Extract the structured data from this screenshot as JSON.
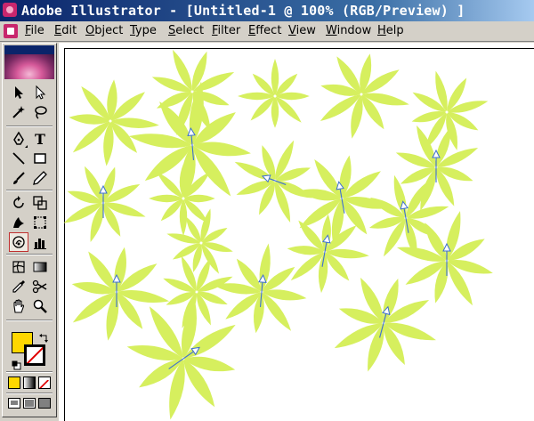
{
  "window": {
    "title": "Adobe Illustrator - [Untitled-1 @ 100% (RGB/Preview) ]",
    "app_icon": "illustrator-flower-icon"
  },
  "menubar": {
    "items": [
      "File",
      "Edit",
      "Object",
      "Type",
      "Select",
      "Filter",
      "Effect",
      "View",
      "Window",
      "Help"
    ]
  },
  "toolbox": {
    "tools": [
      {
        "name": "selection-tool",
        "icon": "black-arrow-icon"
      },
      {
        "name": "direct-selection-tool",
        "icon": "white-arrow-icon"
      },
      {
        "name": "magic-wand-tool",
        "icon": "magic-wand-icon"
      },
      {
        "name": "lasso-tool",
        "icon": "lasso-icon"
      },
      {
        "name": "pen-tool",
        "icon": "pen-icon"
      },
      {
        "name": "type-tool",
        "icon": "type-icon",
        "label": "T"
      },
      {
        "name": "line-segment-tool",
        "icon": "line-icon"
      },
      {
        "name": "rectangle-tool",
        "icon": "rectangle-icon"
      },
      {
        "name": "paintbrush-tool",
        "icon": "paintbrush-icon"
      },
      {
        "name": "pencil-tool",
        "icon": "pencil-icon"
      },
      {
        "name": "rotate-tool",
        "icon": "rotate-icon"
      },
      {
        "name": "scale-tool",
        "icon": "scale-icon"
      },
      {
        "name": "warp-tool",
        "icon": "warp-icon"
      },
      {
        "name": "free-transform-tool",
        "icon": "free-transform-icon"
      },
      {
        "name": "symbol-sprayer-tool",
        "icon": "symbol-sprayer-icon",
        "selected": true
      },
      {
        "name": "column-graph-tool",
        "icon": "graph-icon"
      },
      {
        "name": "mesh-tool",
        "icon": "mesh-icon"
      },
      {
        "name": "gradient-tool",
        "icon": "gradient-icon"
      },
      {
        "name": "eyedropper-tool",
        "icon": "eyedropper-icon"
      },
      {
        "name": "scissors-tool",
        "icon": "scissors-icon"
      },
      {
        "name": "hand-tool",
        "icon": "hand-icon"
      },
      {
        "name": "zoom-tool",
        "icon": "zoom-icon"
      }
    ],
    "fill_color": "#ffd700",
    "stroke_color": "none"
  },
  "colors": {
    "title_bar": "#0a246a",
    "leaf": "#d6ef5e",
    "arrow": "#3d6fd0",
    "chrome": "#d4d0c8"
  },
  "document": {
    "zoom": "100%",
    "mode": "RGB/Preview",
    "symbol": "leaf-flower"
  }
}
